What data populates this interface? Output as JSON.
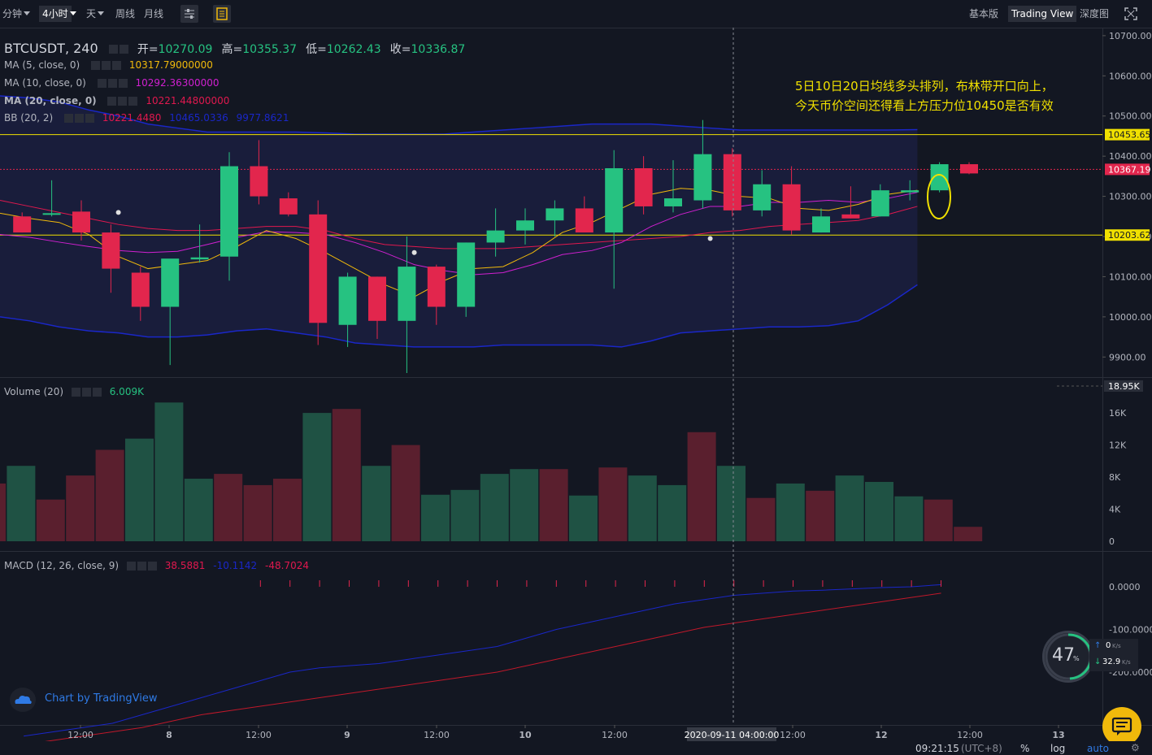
{
  "toolbar": {
    "intervals": [
      "分钟",
      "4小时",
      "天",
      "周线",
      "月线"
    ],
    "views": [
      "基本版",
      "Trading View",
      "深度图"
    ]
  },
  "header": {
    "symbol": "BTCUSDT, 240",
    "open_label": "开=",
    "open": "10270.09",
    "high_label": "高=",
    "high": "10355.37",
    "low_label": "低=",
    "low": "10262.43",
    "close_label": "收=",
    "close": "10336.87"
  },
  "indicators": {
    "ma5": {
      "label": "MA (5, close, 0)",
      "value": "10317.79000000"
    },
    "ma10": {
      "label": "MA (10, close, 0)",
      "value": "10292.36300000"
    },
    "ma20": {
      "label": "MA (20, close, 0)",
      "value": "10221.44800000"
    },
    "bb": {
      "label": "BB (20, 2)",
      "v1": "10221.4480",
      "v2": "10465.0336",
      "v3": "9977.8621"
    },
    "volume": {
      "label": "Volume (20)",
      "value": "6.009K"
    },
    "macd": {
      "label": "MACD (12, 26, close, 9)",
      "v1": "38.5881",
      "v2": "-10.1142",
      "v3": "-48.7024"
    }
  },
  "annotation": {
    "line1": "5日10日20日均线多头排列，布林带开口向上，",
    "line2": "今天币价空间还得看上方压力位10450是否有效"
  },
  "price_scale": {
    "ticks": [
      "10700.00",
      "10600.00",
      "10500.00",
      "10400.00",
      "10300.00",
      "10200.00",
      "10100.00",
      "10000.00",
      "9900.00"
    ],
    "tags": [
      "10453.65",
      "10367.19",
      "10203.62"
    ]
  },
  "volume_scale": {
    "ticks": [
      "16K",
      "12K",
      "8K",
      "4K",
      "0"
    ],
    "top_tag": "18.95K"
  },
  "macd_scale": {
    "ticks": [
      "0.0000",
      "-100.0000",
      "-200.0000"
    ]
  },
  "time_axis": {
    "labels": [
      "12:00",
      "8",
      "12:00",
      "9",
      "12:00",
      "10",
      "12:00",
      "12:00",
      "12",
      "12:00",
      "13"
    ],
    "crosshair_label": "2020-09-11 04:00:00"
  },
  "status": {
    "time": "09:21:15",
    "tz": "(UTC+8)",
    "pct": "%",
    "log": "log",
    "auto": "auto"
  },
  "network": {
    "gauge_value": "47",
    "gauge_unit": "%",
    "up": "0",
    "up_unit": "K/s",
    "down": "32.9",
    "down_unit": "K/s"
  },
  "branding": {
    "text": "Chart by TradingView"
  },
  "colors": {
    "up": "#26c281",
    "down": "#e2264d",
    "bg": "#131722",
    "yellow": "#f0e000"
  },
  "chart_data": {
    "type": "candlestick",
    "symbol": "BTCUSDT",
    "ylim": [
      9850,
      10720
    ],
    "candles": [
      {
        "o": 10250,
        "h": 10260,
        "l": 10210,
        "c": 10210
      },
      {
        "o": 10258,
        "h": 10340,
        "l": 10250,
        "c": 10258
      },
      {
        "o": 10262,
        "h": 10290,
        "l": 10190,
        "c": 10210
      },
      {
        "o": 10210,
        "h": 10230,
        "l": 10060,
        "c": 10120
      },
      {
        "o": 10110,
        "h": 10125,
        "l": 9990,
        "c": 10025
      },
      {
        "o": 10025,
        "h": 10140,
        "l": 9880,
        "c": 10145
      },
      {
        "o": 10143,
        "h": 10230,
        "l": 10135,
        "c": 10148
      },
      {
        "o": 10150,
        "h": 10410,
        "l": 10090,
        "c": 10375
      },
      {
        "o": 10375,
        "h": 10440,
        "l": 10280,
        "c": 10300
      },
      {
        "o": 10295,
        "h": 10310,
        "l": 10250,
        "c": 10255
      },
      {
        "o": 10255,
        "h": 10290,
        "l": 9930,
        "c": 9985
      },
      {
        "o": 9980,
        "h": 10110,
        "l": 9925,
        "c": 10100
      },
      {
        "o": 10100,
        "h": 10100,
        "l": 9945,
        "c": 9990
      },
      {
        "o": 9990,
        "h": 10200,
        "l": 9860,
        "c": 10125
      },
      {
        "o": 10125,
        "h": 10130,
        "l": 9980,
        "c": 10025
      },
      {
        "o": 10025,
        "h": 10185,
        "l": 10000,
        "c": 10185
      },
      {
        "o": 10185,
        "h": 10270,
        "l": 10150,
        "c": 10215
      },
      {
        "o": 10215,
        "h": 10270,
        "l": 10180,
        "c": 10240
      },
      {
        "o": 10240,
        "h": 10290,
        "l": 10200,
        "c": 10270
      },
      {
        "o": 10270,
        "h": 10300,
        "l": 10220,
        "c": 10210
      },
      {
        "o": 10210,
        "h": 10415,
        "l": 10070,
        "c": 10370
      },
      {
        "o": 10370,
        "h": 10400,
        "l": 10255,
        "c": 10275
      },
      {
        "o": 10275,
        "h": 10390,
        "l": 10260,
        "c": 10295
      },
      {
        "o": 10290,
        "h": 10490,
        "l": 10270,
        "c": 10405
      },
      {
        "o": 10405,
        "h": 10420,
        "l": 10250,
        "c": 10265
      },
      {
        "o": 10265,
        "h": 10365,
        "l": 10250,
        "c": 10330
      },
      {
        "o": 10330,
        "h": 10375,
        "l": 10205,
        "c": 10215
      },
      {
        "o": 10210,
        "h": 10270,
        "l": 10210,
        "c": 10250
      },
      {
        "o": 10255,
        "h": 10325,
        "l": 10245,
        "c": 10245
      },
      {
        "o": 10250,
        "h": 10330,
        "l": 10250,
        "c": 10315
      },
      {
        "o": 10310,
        "h": 10340,
        "l": 10290,
        "c": 10315
      },
      {
        "o": 10315,
        "h": 10385,
        "l": 10310,
        "c": 10380
      },
      {
        "o": 10380,
        "h": 10385,
        "l": 10355,
        "c": 10357
      }
    ],
    "volume": [
      7.2,
      9.4,
      5.2,
      8.2,
      11.4,
      12.8,
      17.3,
      7.8,
      8.4,
      7.0,
      7.8,
      16.0,
      16.5,
      9.4,
      12.0,
      5.8,
      6.4,
      8.4,
      9.0,
      9.0,
      5.7,
      9.2,
      8.2,
      7.0,
      13.6,
      9.4,
      5.4,
      7.2,
      6.3,
      8.2,
      7.4,
      5.6,
      5.2,
      1.8
    ],
    "ma5": [
      10258,
      10245,
      10235,
      10205,
      10150,
      10120,
      10130,
      10140,
      10175,
      10215,
      10195,
      10160,
      10120,
      10080,
      10050,
      10090,
      10120,
      10125,
      10160,
      10210,
      10235,
      10270,
      10305,
      10320,
      10315,
      10300,
      10295,
      10270,
      10265,
      10280,
      10305,
      10315
    ],
    "ma10": [
      10205,
      10198,
      10186,
      10175,
      10165,
      10160,
      10163,
      10180,
      10198,
      10212,
      10210,
      10205,
      10185,
      10160,
      10130,
      10115,
      10105,
      10110,
      10130,
      10155,
      10165,
      10185,
      10225,
      10255,
      10275,
      10275,
      10285,
      10285,
      10290,
      10285,
      10295,
      10310
    ],
    "ma20": [
      10290,
      10275,
      10260,
      10245,
      10230,
      10220,
      10215,
      10215,
      10220,
      10225,
      10225,
      10215,
      10195,
      10180,
      10175,
      10170,
      10170,
      10170,
      10175,
      10180,
      10185,
      10190,
      10195,
      10200,
      10210,
      10215,
      10225,
      10230,
      10235,
      10240,
      10255,
      10275
    ],
    "bb_upper": [
      10550,
      10545,
      10535,
      10515,
      10500,
      10480,
      10470,
      10460,
      10460,
      10460,
      10460,
      10458,
      10455,
      10455,
      10455,
      10455,
      10460,
      10465,
      10470,
      10475,
      10480,
      10480,
      10480,
      10475,
      10470,
      10465,
      10465,
      10465,
      10465,
      10465,
      10465,
      10466
    ],
    "bb_lower": [
      10000,
      9990,
      9975,
      9965,
      9960,
      9950,
      9950,
      9955,
      9965,
      9970,
      9960,
      9950,
      9935,
      9930,
      9925,
      9925,
      9925,
      9930,
      9930,
      9930,
      9930,
      9925,
      9940,
      9960,
      9965,
      9970,
      9975,
      9975,
      9978,
      9990,
      10030,
      10080
    ],
    "bb_dots": [
      {
        "i": 3,
        "v": 10260
      },
      {
        "i": 13,
        "v": 10160
      },
      {
        "i": 23,
        "v": 10195
      }
    ],
    "horizontal_lines": [
      10453.65,
      10203.62
    ],
    "current_price": 10367.19,
    "macd": [
      -350,
      -340,
      -330,
      -320,
      -300,
      -280,
      -260,
      -240,
      -220,
      -200,
      -190,
      -185,
      -180,
      -170,
      -160,
      -150,
      -140,
      -120,
      -100,
      -85,
      -70,
      -55,
      -40,
      -30,
      -20,
      -15,
      -10,
      -8,
      -5,
      -2,
      0,
      5
    ],
    "signal": [
      -370,
      -360,
      -350,
      -340,
      -330,
      -315,
      -300,
      -290,
      -280,
      -270,
      -260,
      -250,
      -240,
      -230,
      -220,
      -210,
      -200,
      -185,
      -170,
      -155,
      -140,
      -125,
      -110,
      -95,
      -85,
      -75,
      -65,
      -55,
      -45,
      -35,
      -25,
      -15
    ]
  }
}
